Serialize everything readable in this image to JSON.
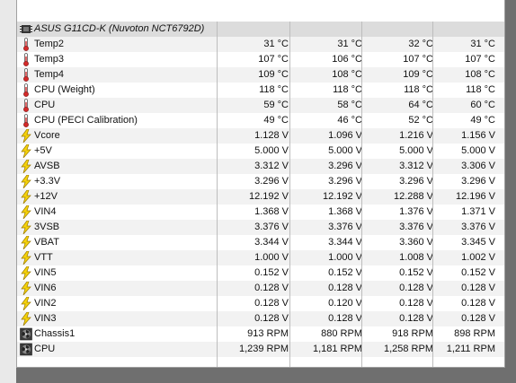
{
  "section_title": "ASUS G11CD-K (Nuvoton NCT6792D)",
  "sensors": [
    {
      "type": "temp",
      "label": "Temp2",
      "values": [
        "31 °C",
        "31 °C",
        "32 °C",
        "31 °C"
      ]
    },
    {
      "type": "temp",
      "label": "Temp3",
      "values": [
        "107 °C",
        "106 °C",
        "107 °C",
        "107 °C"
      ]
    },
    {
      "type": "temp",
      "label": "Temp4",
      "values": [
        "109 °C",
        "108 °C",
        "109 °C",
        "108 °C"
      ]
    },
    {
      "type": "temp",
      "label": "CPU (Weight)",
      "values": [
        "118 °C",
        "118 °C",
        "118 °C",
        "118 °C"
      ]
    },
    {
      "type": "temp",
      "label": "CPU",
      "values": [
        "59 °C",
        "58 °C",
        "64 °C",
        "60 °C"
      ]
    },
    {
      "type": "temp",
      "label": "CPU (PECI Calibration)",
      "values": [
        "49 °C",
        "46 °C",
        "52 °C",
        "49 °C"
      ]
    },
    {
      "type": "volt",
      "label": "Vcore",
      "values": [
        "1.128 V",
        "1.096 V",
        "1.216 V",
        "1.156 V"
      ]
    },
    {
      "type": "volt",
      "label": "+5V",
      "values": [
        "5.000 V",
        "5.000 V",
        "5.000 V",
        "5.000 V"
      ]
    },
    {
      "type": "volt",
      "label": "AVSB",
      "values": [
        "3.312 V",
        "3.296 V",
        "3.312 V",
        "3.306 V"
      ]
    },
    {
      "type": "volt",
      "label": "+3.3V",
      "values": [
        "3.296 V",
        "3.296 V",
        "3.296 V",
        "3.296 V"
      ]
    },
    {
      "type": "volt",
      "label": "+12V",
      "values": [
        "12.192 V",
        "12.192 V",
        "12.288 V",
        "12.196 V"
      ]
    },
    {
      "type": "volt",
      "label": "VIN4",
      "values": [
        "1.368 V",
        "1.368 V",
        "1.376 V",
        "1.371 V"
      ]
    },
    {
      "type": "volt",
      "label": "3VSB",
      "values": [
        "3.376 V",
        "3.376 V",
        "3.376 V",
        "3.376 V"
      ]
    },
    {
      "type": "volt",
      "label": "VBAT",
      "values": [
        "3.344 V",
        "3.344 V",
        "3.360 V",
        "3.345 V"
      ]
    },
    {
      "type": "volt",
      "label": "VTT",
      "values": [
        "1.000 V",
        "1.000 V",
        "1.008 V",
        "1.002 V"
      ]
    },
    {
      "type": "volt",
      "label": "VIN5",
      "values": [
        "0.152 V",
        "0.152 V",
        "0.152 V",
        "0.152 V"
      ]
    },
    {
      "type": "volt",
      "label": "VIN6",
      "values": [
        "0.128 V",
        "0.128 V",
        "0.128 V",
        "0.128 V"
      ]
    },
    {
      "type": "volt",
      "label": "VIN2",
      "values": [
        "0.128 V",
        "0.120 V",
        "0.128 V",
        "0.128 V"
      ]
    },
    {
      "type": "volt",
      "label": "VIN3",
      "values": [
        "0.128 V",
        "0.128 V",
        "0.128 V",
        "0.128 V"
      ]
    },
    {
      "type": "fan",
      "label": "Chassis1",
      "values": [
        "913 RPM",
        "880 RPM",
        "918 RPM",
        "898 RPM"
      ]
    },
    {
      "type": "fan",
      "label": "CPU",
      "values": [
        "1,239 RPM",
        "1,181 RPM",
        "1,258 RPM",
        "1,211 RPM"
      ]
    }
  ],
  "icons": {
    "temp": "thermometer-icon",
    "volt": "lightning-icon",
    "fan": "fan-icon",
    "chip": "chip-icon"
  },
  "colors": {
    "header_bg": "#dcdcdc",
    "row_alt": "#f2f2f2",
    "thermo_red": "#d42a2a",
    "bolt_yellow": "#f5d20a"
  }
}
